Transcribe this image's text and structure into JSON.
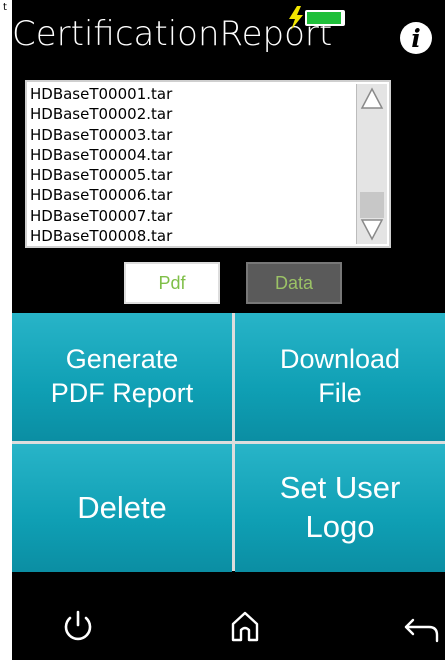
{
  "app": {
    "title": "CertificationReport",
    "corner_char": "t"
  },
  "status": {
    "battery_icon": "battery-charging-icon"
  },
  "file_list": {
    "items": [
      "HDBaseT00001.tar",
      "HDBaseT00002.tar",
      "HDBaseT00003.tar",
      "HDBaseT00004.tar",
      "HDBaseT00005.tar",
      "HDBaseT00006.tar",
      "HDBaseT00007.tar",
      "HDBaseT00008.tar"
    ]
  },
  "toggles": {
    "pdf_label": "Pdf",
    "data_label": "Data"
  },
  "actions": {
    "generate_line1": "Generate",
    "generate_line2": "PDF Report",
    "download_line1": "Download",
    "download_line2": "File",
    "delete_label": "Delete",
    "logo_line1": "Set User",
    "logo_line2": "Logo"
  },
  "nav": {
    "power": "power-icon",
    "home": "home-icon",
    "back": "back-arrow-icon"
  },
  "colors": {
    "button_teal": "#1aa9bd",
    "battery_green": "#1fbf3a",
    "pdf_text": "#7fbf48",
    "data_bg": "#5a5a5a"
  }
}
